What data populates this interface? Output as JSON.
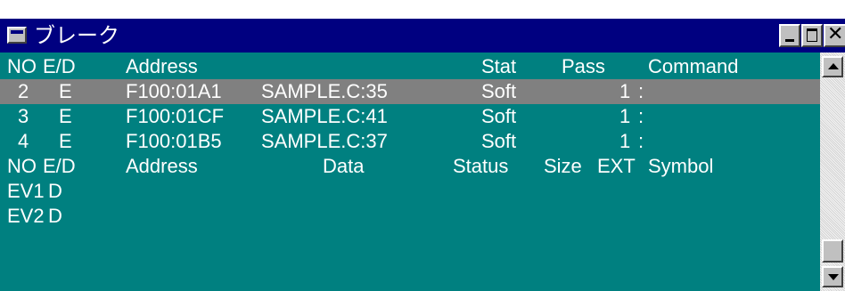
{
  "window": {
    "title": "ブレーク",
    "close_glyph": "✕"
  },
  "colors": {
    "titlebar": "#000080",
    "content_bg": "#008080",
    "selected_bg": "#808080",
    "text": "#ffffff"
  },
  "break_table": {
    "headers": {
      "no": "NO",
      "ed": "E/D",
      "address": "Address",
      "stat": "Stat",
      "pass": "Pass",
      "command": "Command"
    },
    "rows": [
      {
        "no": "2",
        "ed": "E",
        "address": "F100:01A1",
        "symbol": "SAMPLE.C:35",
        "stat": "Soft",
        "pass": "1",
        "sep": ":"
      },
      {
        "no": "3",
        "ed": "E",
        "address": "F100:01CF",
        "symbol": "SAMPLE.C:41",
        "stat": "Soft",
        "pass": "1",
        "sep": ":"
      },
      {
        "no": "4",
        "ed": "E",
        "address": "F100:01B5",
        "symbol": "SAMPLE.C:37",
        "stat": "Soft",
        "pass": "1",
        "sep": ":"
      }
    ]
  },
  "event_table": {
    "headers": {
      "no": "NO",
      "ed": "E/D",
      "address": "Address",
      "data": "Data",
      "status": "Status",
      "size": "Size",
      "ext": "EXT",
      "symbol": "Symbol"
    },
    "rows": [
      {
        "no": "EV1",
        "ed": "D"
      },
      {
        "no": "EV2",
        "ed": "D"
      }
    ]
  },
  "scrollbar": {
    "up_icon": "up-arrow-icon",
    "down_icon": "down-arrow-icon"
  }
}
